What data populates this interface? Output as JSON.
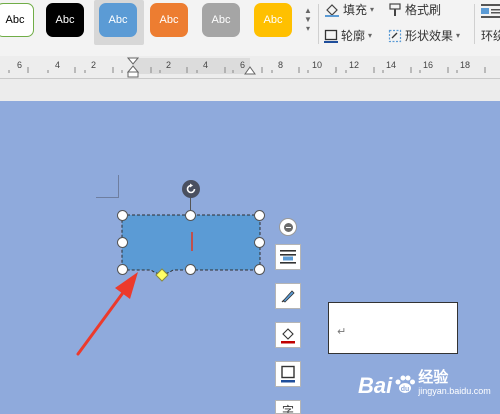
{
  "ribbon": {
    "style_swatches": [
      {
        "label": "Abc",
        "fill": "#ffffff",
        "text_color": "#000000",
        "border": "#70ad47"
      },
      {
        "label": "Abc",
        "fill": "#000000",
        "text_color": "#ffffff",
        "border": "#000000"
      },
      {
        "label": "Abc",
        "fill": "#5b9bd5",
        "text_color": "#ffffff",
        "border": "#5b9bd5"
      },
      {
        "label": "Abc",
        "fill": "#ed7d31",
        "text_color": "#ffffff",
        "border": "#ed7d31"
      },
      {
        "label": "Abc",
        "fill": "#a5a5a5",
        "text_color": "#ffffff",
        "border": "#a5a5a5"
      },
      {
        "label": "Abc",
        "fill": "#ffc000",
        "text_color": "#ffffff",
        "border": "#ffc000"
      }
    ],
    "fill_label": "填充",
    "outline_label": "轮廓",
    "format_painter_label": "格式刷",
    "shape_effects_label": "形状效果",
    "wrap_label": "环绕"
  },
  "ruler": {
    "ticks": [
      "6",
      "4",
      "2",
      "2",
      "4",
      "6",
      "8",
      "10",
      "12",
      "14",
      "16",
      "18"
    ]
  },
  "shape": {
    "fill": "#5b9bd5",
    "adjust_handle_color": "#ffff66"
  },
  "textbox": {
    "paragraph_mark": "↵"
  },
  "side_toolbar": {
    "items": [
      "collapse-icon",
      "layout-options-icon",
      "shape-style-icon",
      "shape-fill-icon",
      "shape-outline-icon",
      "text-icon"
    ],
    "text_button_label": "字"
  },
  "arrow_color": "#ec3a2c",
  "watermark": {
    "brand_text": "Bai",
    "paw_text": "du",
    "cn_text": "经验",
    "url": "jingyan.baidu.com"
  }
}
